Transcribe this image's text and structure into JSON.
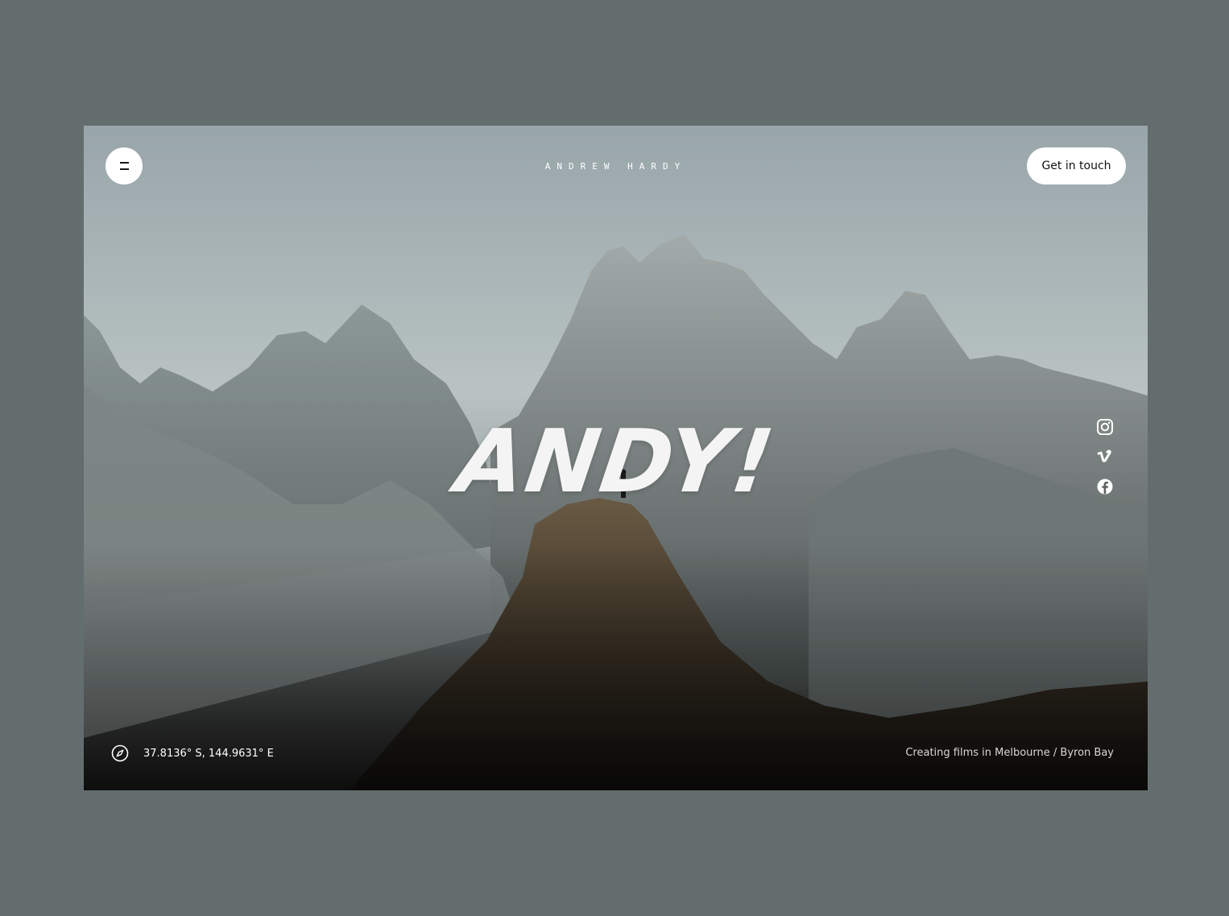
{
  "header": {
    "brand": "ANDREW HARDY",
    "menu_icon": "hamburger-menu-icon",
    "cta_label": "Get in touch"
  },
  "hero": {
    "title": "ANDY!"
  },
  "social": {
    "items": [
      {
        "name": "instagram",
        "icon": "instagram-icon"
      },
      {
        "name": "vimeo",
        "icon": "vimeo-icon"
      },
      {
        "name": "facebook",
        "icon": "facebook-icon"
      }
    ]
  },
  "footer": {
    "compass_icon": "compass-icon",
    "coordinates": "37.8136° S, 144.9631° E",
    "tagline": "Creating films in Melbourne / Byron Bay"
  },
  "colors": {
    "page_background": "#646d6e",
    "button_background": "#ffffff",
    "text": "#ffffff"
  }
}
